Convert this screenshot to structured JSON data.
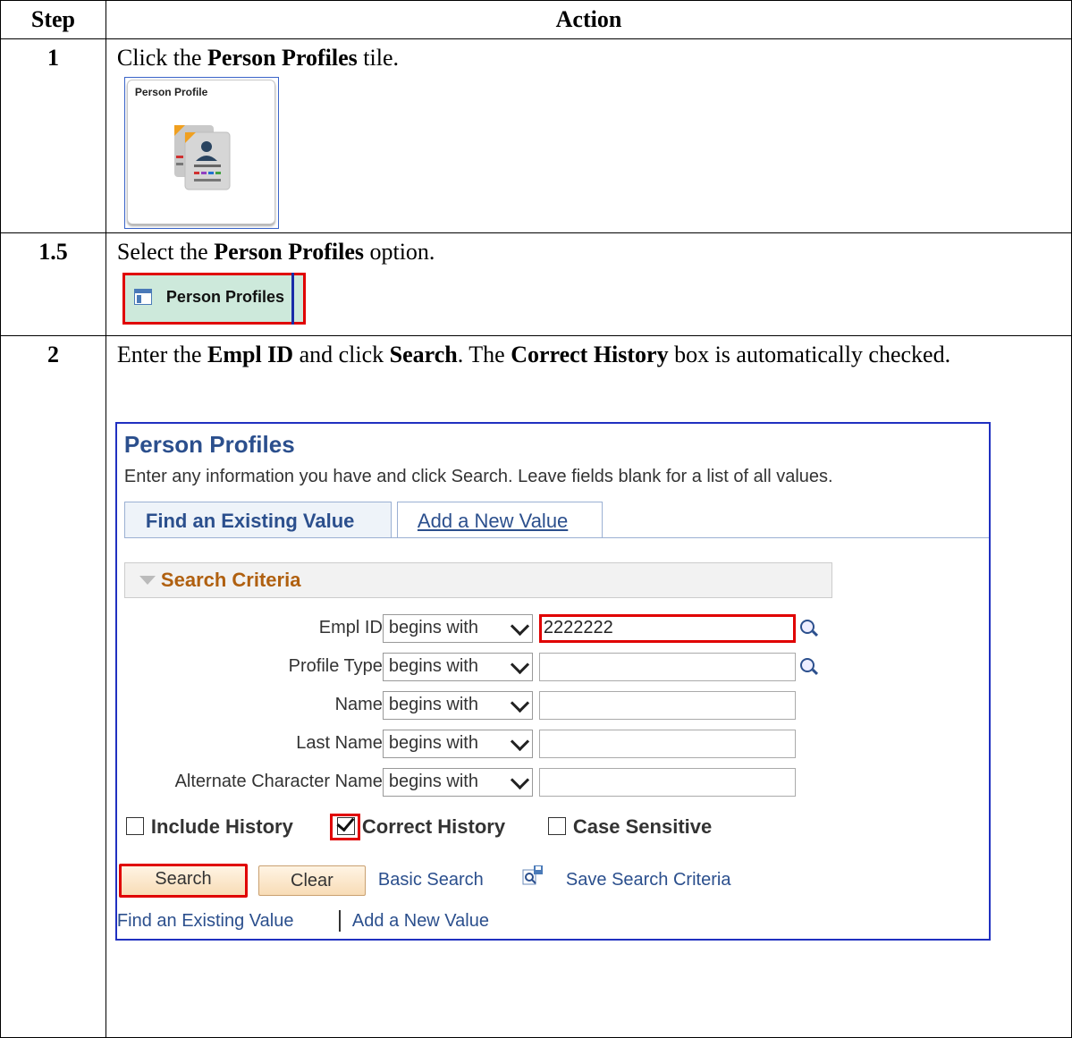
{
  "header": {
    "step": "Step",
    "action": "Action"
  },
  "rows": [
    {
      "step": "1",
      "pre": "Click the ",
      "bold": "Person Profiles",
      "post": " tile.",
      "tile_title": "Person Profile"
    },
    {
      "step": "1.5",
      "pre": "Select the ",
      "bold": "Person Profiles",
      "post": " option.",
      "option_label": "Person Profiles"
    },
    {
      "step": "2",
      "i1": "Enter the ",
      "b1": "Empl ID",
      "i2": " and click ",
      "b2": "Search",
      "i3": ". The ",
      "b3": "Correct History",
      "i4": " box is automatically checked."
    }
  ],
  "panel": {
    "title": "Person Profiles",
    "description": "Enter any information you have and click Search. Leave fields blank for a list of all values.",
    "tab_find": "Find an Existing Value",
    "tab_add": "Add a New Value",
    "criteria": "Search Criteria",
    "fields": [
      {
        "label": "Empl ID",
        "op": "begins with",
        "value": "2222222"
      },
      {
        "label": "Profile Type",
        "op": "begins with",
        "value": ""
      },
      {
        "label": "Name",
        "op": "begins with",
        "value": ""
      },
      {
        "label": "Last Name",
        "op": "begins with",
        "value": ""
      },
      {
        "label": "Alternate Character Name",
        "op": "begins with",
        "value": ""
      }
    ],
    "include_history": "Include History",
    "correct_history": "Correct History",
    "case_sensitive": "Case Sensitive",
    "search_btn": "Search",
    "clear_btn": "Clear",
    "basic_search": "Basic Search",
    "save_criteria": "Save Search Criteria",
    "bottom_find": "Find an Existing Value",
    "bottom_add": "Add a New Value"
  }
}
